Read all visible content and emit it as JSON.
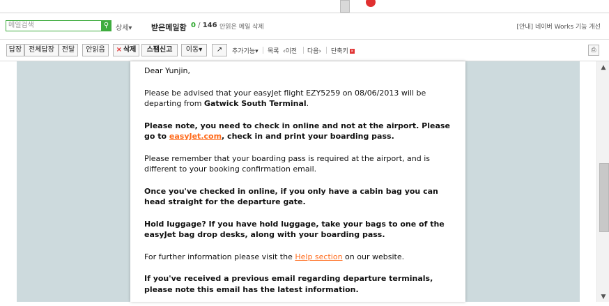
{
  "search": {
    "placeholder": "메일검색",
    "detail_label": "상세"
  },
  "header": {
    "folder_title": "받은메일함",
    "unread_count": "0",
    "separator": "/",
    "total_count": "146",
    "delete_unread_label": "안읽은 메일 삭제",
    "notice": "[안내] 네이버 Works 기능 개선"
  },
  "toolbar": {
    "reply": "답장",
    "reply_all": "전체답장",
    "forward": "전달",
    "mark_unread": "안읽음",
    "delete_x": "×",
    "delete": "삭제",
    "spam": "스팸신고",
    "move": "이동",
    "move_arrow": "▾",
    "share_icon": "↗",
    "more": "추가기능",
    "more_arrow": "▾",
    "list": "목록",
    "prev": "‹이전",
    "next": "다음›",
    "shortcut": "단축키",
    "shortcut_x": "×",
    "print_icon": "⎙"
  },
  "email": {
    "greeting": "Dear Yunjin,",
    "p1_pre": "Please be advised that your easyJet flight EZY5259 on 08/06/2013 will be departing from ",
    "p1_bold": "Gatwick South Terminal",
    "p1_post": ".",
    "p2_pre": "Please note, you need to check in online and not at the airport. Please go to ",
    "p2_link": "easyJet.com",
    "p2_post": ", check in and print your boarding pass.",
    "p3": "Please remember that your boarding pass is required at the airport, and is different to your booking confirmation email.",
    "p4": "Once you've checked in online, if you only have a cabin bag you can head straight for the departure gate.",
    "p5": "Hold luggage? If you have hold luggage, take your bags to one of the easyJet bag drop desks, along with your boarding pass.",
    "p6_pre": "For further information please visit the ",
    "p6_link": "Help section",
    "p6_post": " on our website.",
    "p7": "If you've received a previous email regarding departure terminals, please note this email has the latest information."
  },
  "scrollbar": {
    "up": "▲",
    "down": "▼"
  },
  "colors": {
    "accent_green": "#3eac3e",
    "link_orange": "#ff6a1a",
    "frame_bg": "#cddadd",
    "delete_red": "#e03030"
  }
}
